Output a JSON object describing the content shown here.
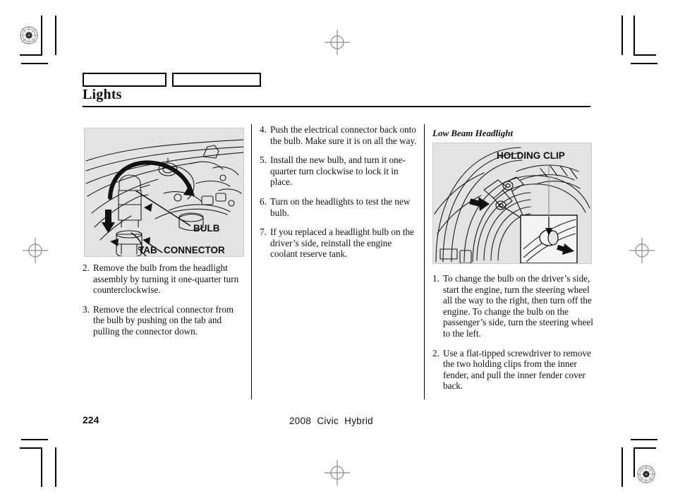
{
  "document": {
    "section_title": "Lights",
    "page_number": "224",
    "running_footer": "2008  Civic  Hybrid"
  },
  "header": {
    "tabs": [
      {
        "label": "",
        "name": "header-tab-1"
      },
      {
        "label": "",
        "name": "header-tab-2"
      }
    ]
  },
  "left_column": {
    "figure": {
      "name": "headlight-bulb-removal-figure",
      "labels": [
        {
          "text": "BULB",
          "name": "bulb-label"
        },
        {
          "text": "TAB",
          "name": "tab-label"
        },
        {
          "text": "CONNECTOR",
          "name": "connector-label"
        }
      ]
    },
    "steps": [
      {
        "num": "2.",
        "text": "Remove the bulb from the headlight assembly by turning it one-quarter turn counterclockwise."
      },
      {
        "num": "3.",
        "text": "Remove the electrical connector from the bulb by pushing on the tab and pulling the connector down."
      }
    ]
  },
  "middle_column": {
    "steps": [
      {
        "num": "4.",
        "text": "Push the electrical connector back onto the bulb. Make sure it is on all the way."
      },
      {
        "num": "5.",
        "text": "Install the new bulb, and turn it one-quarter turn clockwise to lock it in place."
      },
      {
        "num": "6.",
        "text": "Turn on the headlights to test the new bulb."
      },
      {
        "num": "7.",
        "text": "If you replaced a headlight bulb on the driver’s side, reinstall the engine coolant reserve tank."
      }
    ]
  },
  "right_column": {
    "heading": "Low Beam Headlight",
    "figure": {
      "name": "wheel-well-holding-clip-figure",
      "labels": [
        {
          "text": "HOLDING CLIP",
          "name": "holding-clip-label"
        }
      ]
    },
    "steps": [
      {
        "num": "1.",
        "text": "To change the bulb on the driver’s side, start the engine, turn the steering wheel all the way to the right, then turn off the engine. To change the bulb on the passenger’s side, turn the steering wheel to the left."
      },
      {
        "num": "2.",
        "text": "Use a flat-tipped screwdriver to remove the two holding clips from the inner fender, and pull the inner fender cover back."
      }
    ]
  },
  "print_marks": {
    "registration_targets": [
      "top-left",
      "bottom-right"
    ],
    "crosshairs": [
      "top-center",
      "left-middle",
      "right-middle",
      "bottom-center"
    ],
    "colors": {
      "ink": "#000000",
      "figure_background": "#e3e3e3"
    }
  }
}
